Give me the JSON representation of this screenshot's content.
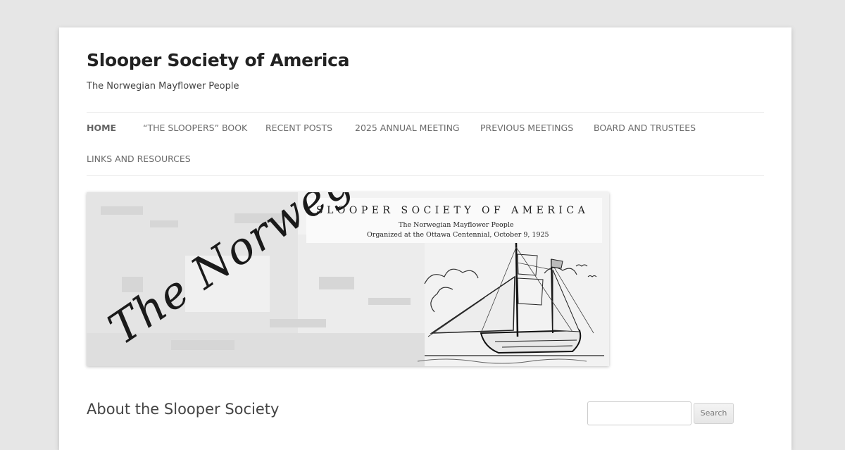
{
  "site": {
    "title": "Slooper Society of America",
    "description": "The Norwegian Mayflower People"
  },
  "nav": {
    "items": [
      {
        "label": "HOME",
        "current": true
      },
      {
        "label": "“THE SLOOPERS” BOOK"
      },
      {
        "label": "RECENT POSTS"
      },
      {
        "label": "2025 ANNUAL MEETING"
      },
      {
        "label": "PREVIOUS MEETINGS"
      },
      {
        "label": "BOARD AND TRUSTEES"
      },
      {
        "label": "LINKS AND RESOURCES"
      }
    ]
  },
  "banner": {
    "script_text": "The Norwegian",
    "title": "SLOOPER SOCIETY OF AMERICA",
    "subtitle": "The Norwegian Mayflower People",
    "organized": "Organized at the Ottawa Centennial, October 9, 1925"
  },
  "content": {
    "heading": "About the Slooper Society"
  },
  "search": {
    "button_label": "Search",
    "value": ""
  }
}
